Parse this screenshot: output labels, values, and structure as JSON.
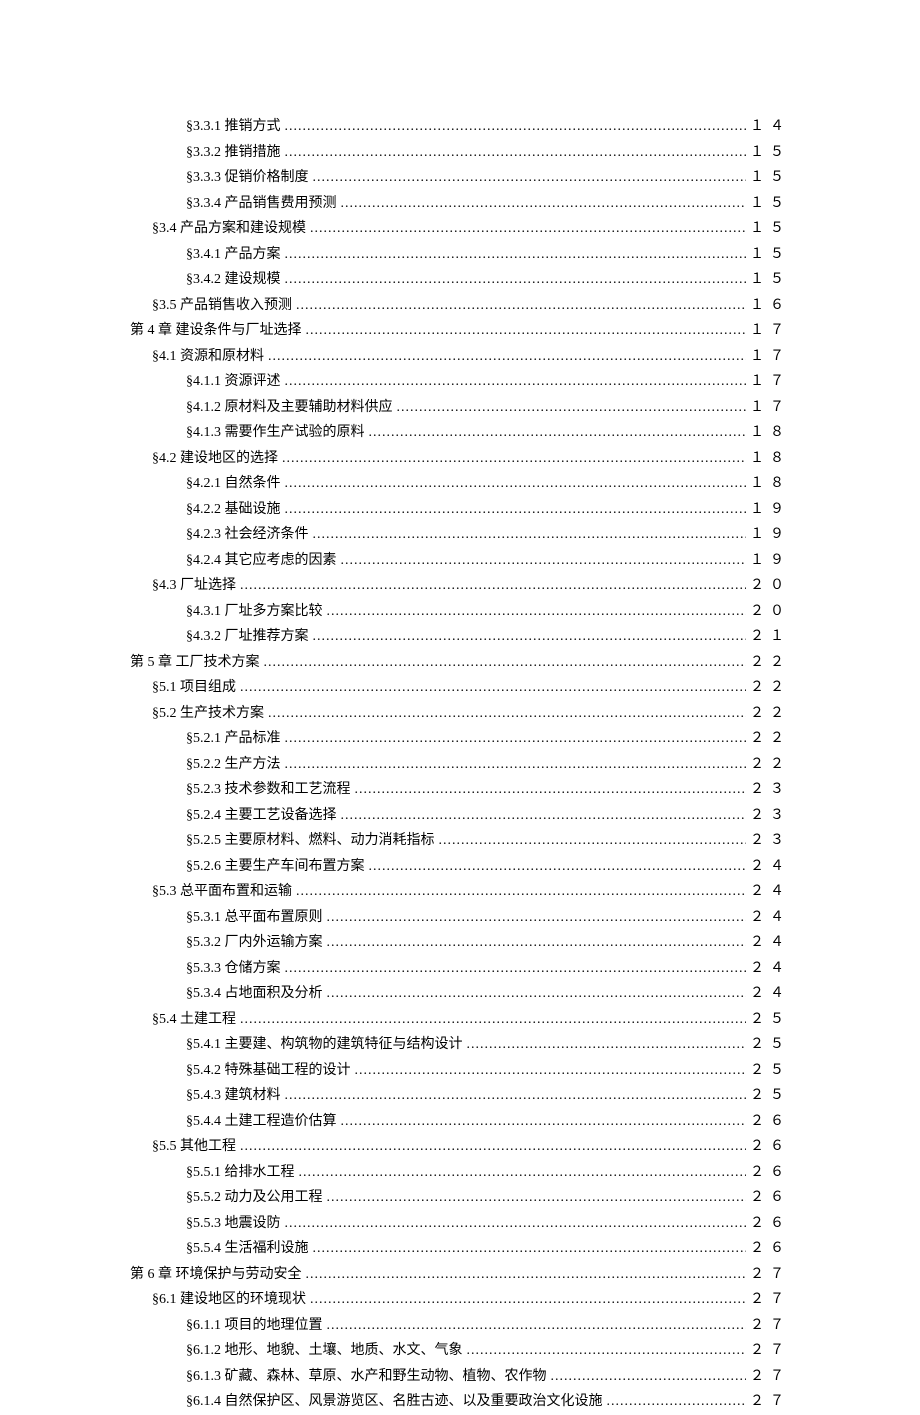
{
  "toc": [
    {
      "level": 2,
      "label": "§3.3.1 推销方式",
      "page": "１４"
    },
    {
      "level": 2,
      "label": "§3.3.2 推销措施",
      "page": "１５"
    },
    {
      "level": 2,
      "label": "§3.3.3 促销价格制度",
      "page": "１５"
    },
    {
      "level": 2,
      "label": "§3.3.4 产品销售费用预测",
      "page": "１５"
    },
    {
      "level": 1,
      "label": "§3.4 产品方案和建设规模",
      "page": "１５"
    },
    {
      "level": 2,
      "label": "§3.4.1 产品方案",
      "page": "１５"
    },
    {
      "level": 2,
      "label": "§3.4.2 建设规模",
      "page": "１５"
    },
    {
      "level": 1,
      "label": "§3.5 产品销售收入预测",
      "page": "１６"
    },
    {
      "level": 0,
      "label": "第 4 章 建设条件与厂址选择",
      "page": "１７"
    },
    {
      "level": 1,
      "label": "§4.1 资源和原材料",
      "page": "１７"
    },
    {
      "level": 2,
      "label": "§4.1.1 资源评述",
      "page": "１７"
    },
    {
      "level": 2,
      "label": "§4.1.2 原材料及主要辅助材料供应",
      "page": "１７"
    },
    {
      "level": 2,
      "label": "§4.1.3 需要作生产试验的原料",
      "page": "１８"
    },
    {
      "level": 1,
      "label": "§4.2 建设地区的选择",
      "page": "１８"
    },
    {
      "level": 2,
      "label": "§4.2.1 自然条件",
      "page": "１８"
    },
    {
      "level": 2,
      "label": "§4.2.2 基础设施",
      "page": "１９"
    },
    {
      "level": 2,
      "label": "§4.2.3 社会经济条件",
      "page": "１９"
    },
    {
      "level": 2,
      "label": "§4.2.4 其它应考虑的因素",
      "page": "１９"
    },
    {
      "level": 1,
      "label": "§4.3 厂址选择",
      "page": "２０"
    },
    {
      "level": 2,
      "label": "§4.3.1 厂址多方案比较",
      "page": "２０"
    },
    {
      "level": 2,
      "label": "§4.3.2 厂址推荐方案",
      "page": "２１"
    },
    {
      "level": 0,
      "label": "第 5 章 工厂技术方案",
      "page": "２２"
    },
    {
      "level": 1,
      "label": "§5.1 项目组成",
      "page": "２２"
    },
    {
      "level": 1,
      "label": "§5.2 生产技术方案",
      "page": "２２"
    },
    {
      "level": 2,
      "label": "§5.2.1 产品标准",
      "page": "２２"
    },
    {
      "level": 2,
      "label": "§5.2.2 生产方法",
      "page": "２２"
    },
    {
      "level": 2,
      "label": "§5.2.3 技术参数和工艺流程",
      "page": "２３"
    },
    {
      "level": 2,
      "label": "§5.2.4 主要工艺设备选择",
      "page": "２３"
    },
    {
      "level": 2,
      "label": "§5.2.5 主要原材料、燃料、动力消耗指标",
      "page": "２３"
    },
    {
      "level": 2,
      "label": "§5.2.6 主要生产车间布置方案",
      "page": "２４"
    },
    {
      "level": 1,
      "label": "§5.3 总平面布置和运输",
      "page": "２４"
    },
    {
      "level": 2,
      "label": "§5.3.1 总平面布置原则",
      "page": "２４"
    },
    {
      "level": 2,
      "label": "§5.3.2 厂内外运输方案",
      "page": "２４"
    },
    {
      "level": 2,
      "label": "§5.3.3 仓储方案",
      "page": "２４"
    },
    {
      "level": 2,
      "label": "§5.3.4 占地面积及分析",
      "page": "２４"
    },
    {
      "level": 1,
      "label": "§5.4 土建工程",
      "page": "２５"
    },
    {
      "level": 2,
      "label": "§5.4.1 主要建、构筑物的建筑特征与结构设计",
      "page": "２５"
    },
    {
      "level": 2,
      "label": "§5.4.2 特殊基础工程的设计",
      "page": "２５"
    },
    {
      "level": 2,
      "label": "§5.4.3 建筑材料",
      "page": "２５"
    },
    {
      "level": 2,
      "label": "§5.4.4 土建工程造价估算",
      "page": "２６"
    },
    {
      "level": 1,
      "label": "§5.5 其他工程",
      "page": "２６"
    },
    {
      "level": 2,
      "label": "§5.5.1 给排水工程",
      "page": "２６"
    },
    {
      "level": 2,
      "label": "§5.5.2 动力及公用工程",
      "page": "２６"
    },
    {
      "level": 2,
      "label": "§5.5.3 地震设防",
      "page": "２６"
    },
    {
      "level": 2,
      "label": "§5.5.4 生活福利设施",
      "page": "２６"
    },
    {
      "level": 0,
      "label": "第 6 章 环境保护与劳动安全",
      "page": "２７"
    },
    {
      "level": 1,
      "label": "§6.1 建设地区的环境现状",
      "page": "２７"
    },
    {
      "level": 2,
      "label": "§6.1.1 项目的地理位置",
      "page": "２７"
    },
    {
      "level": 2,
      "label": "§6.1.2 地形、地貌、土壤、地质、水文、气象",
      "page": "２７"
    },
    {
      "level": 2,
      "label": "§6.1.3 矿藏、森林、草原、水产和野生动物、植物、农作物",
      "page": "２７"
    },
    {
      "level": 2,
      "label": "§6.1.4 自然保护区、风景游览区、名胜古迹、以及重要政治文化设施",
      "page": "２７"
    }
  ]
}
